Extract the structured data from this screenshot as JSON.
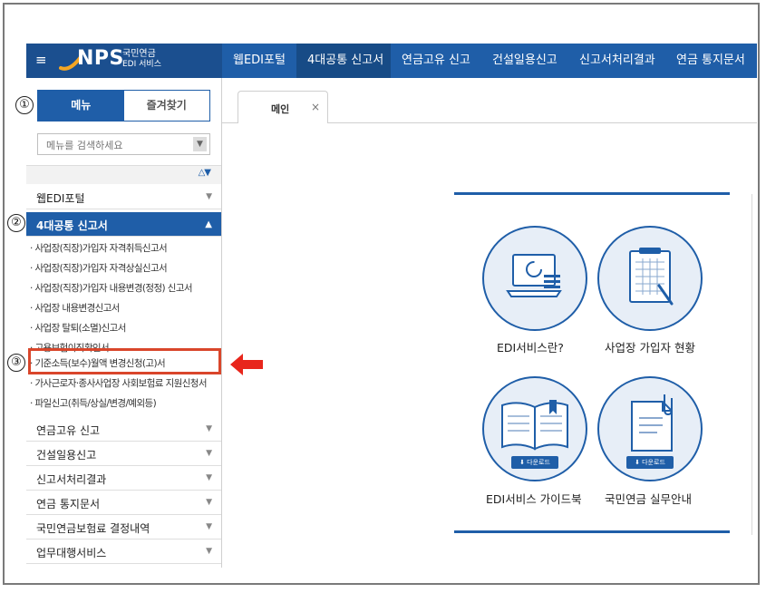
{
  "topbar": {
    "menu_icon": "hamburger-icon",
    "logo": {
      "name": "NPS",
      "sub1": "국민연금",
      "sub2": "EDI 서비스"
    },
    "menu": [
      "웹EDI포털",
      "4대공통 신고서",
      "연금고유 신고",
      "건설일용신고",
      "신고서처리결과",
      "연금 통지문서"
    ]
  },
  "sidebar": {
    "tabs": {
      "menu": "메뉴",
      "favorites": "즐겨찾기"
    },
    "search_placeholder": "메뉴를 검색하세요",
    "sections": {
      "web_edi": "웹EDI포털",
      "common4": "4대공통 신고서",
      "pension": "연금고유 신고",
      "construction": "건설일용신고",
      "result": "신고서처리결과",
      "notice": "연금 통지문서",
      "premium": "국민연금보험료 결정내역",
      "agency": "업무대행서비스"
    },
    "subitems": [
      "· 사업장(직장)가입자 자격취득신고서",
      "· 사업장(직장)가입자 자격상실신고서",
      "· 사업장(직장)가입자 내용변경(정정) 신고서",
      "· 사업장 내용변경신고서",
      "· 사업장 탈퇴(소멸)신고서",
      "· 고용보험이직확인서",
      "· 기준소득(보수)월액 변경신청(고)서",
      "· 가사근로자·종사사업장 사회보험료 지원신청서",
      "· 파일신고(취득/상실/변경/예외등)"
    ]
  },
  "annotations": {
    "n1": "①",
    "n2": "②",
    "n3": "③"
  },
  "colors": {
    "accent": "#1f5ea8",
    "highlight": "#d9462b",
    "arrow": "#e8261c"
  },
  "main": {
    "tab_label": "메인",
    "tab_close": "×",
    "cards": {
      "edi_about": "EDI서비스란?",
      "members": "사업장 가입자 현황",
      "guidebook": "EDI서비스 가이드북",
      "manual": "국민연금 실무안내",
      "download": "다운로드"
    }
  }
}
